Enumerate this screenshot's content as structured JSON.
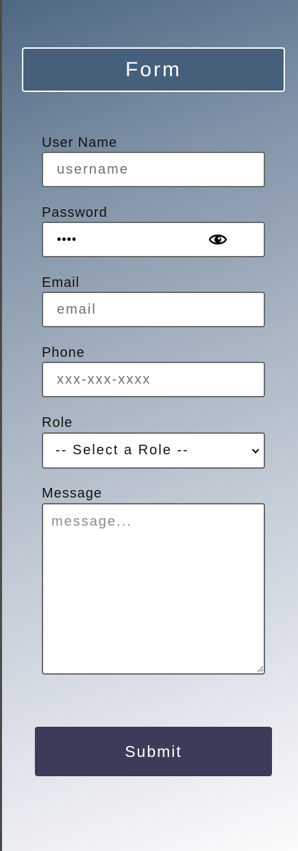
{
  "form": {
    "title": "Form",
    "fields": {
      "username": {
        "label": "User Name",
        "placeholder": "username"
      },
      "password": {
        "label": "Password",
        "value": "••••"
      },
      "email": {
        "label": "Email",
        "placeholder": "email"
      },
      "phone": {
        "label": "Phone",
        "placeholder": "xxx-xxx-xxxx"
      },
      "role": {
        "label": "Role",
        "selected": "-- Select a Role --"
      },
      "message": {
        "label": "Message",
        "placeholder": "message..."
      }
    },
    "submit_label": "Submit"
  },
  "icons": {
    "password_toggle": "eye-icon",
    "role_dropdown": "chevron-down-icon",
    "textarea_resize": "resize-grip-icon"
  },
  "colors": {
    "title_bg": "#46607c",
    "submit_bg": "#3c3c5a",
    "gradient_top": "#4e6783",
    "gradient_bottom": "#fbfbfc"
  }
}
